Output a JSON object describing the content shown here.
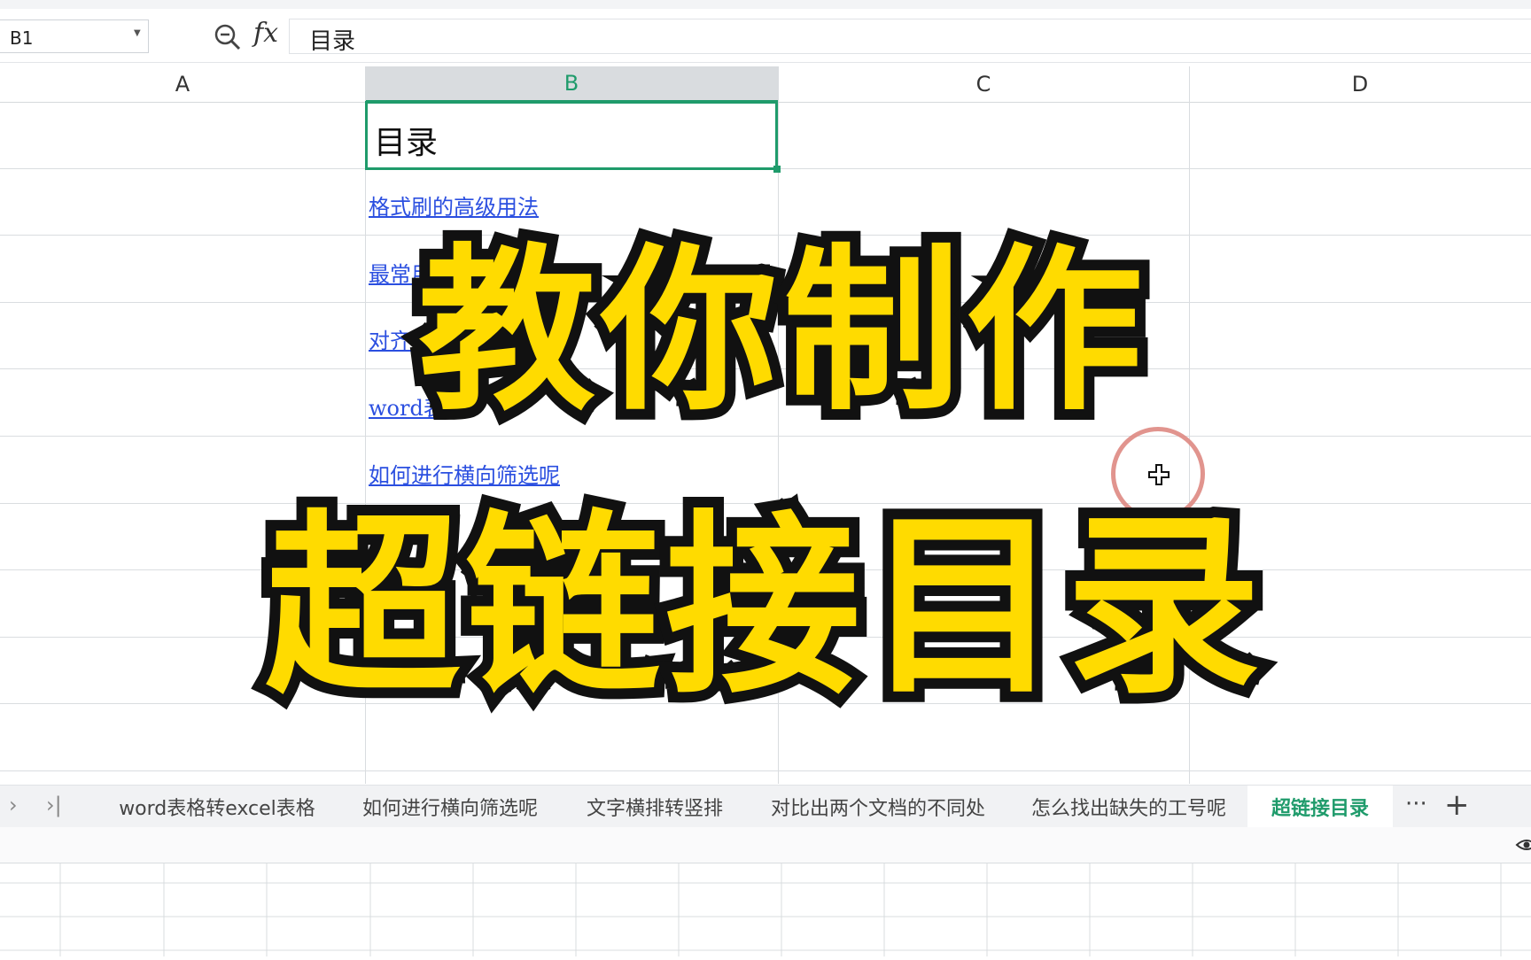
{
  "formula_bar": {
    "cell_ref": "B1",
    "fx_symbol": "fx",
    "formula_value": "目录"
  },
  "columns": [
    "A",
    "B",
    "C",
    "D"
  ],
  "sheet": {
    "title_cell": "目录",
    "links": [
      "格式刷的高级用法",
      "最常用的",
      "对齐名",
      "word表",
      "如何进行横向筛选呢"
    ]
  },
  "overlay": {
    "line1": "教你制作",
    "line2": "超链接目录",
    "fill_color": "#ffdb00",
    "stroke_color": "#111111"
  },
  "tabs": [
    {
      "label": "word表格转excel表格",
      "active": false
    },
    {
      "label": "如何进行横向筛选呢",
      "active": false
    },
    {
      "label": "文字横排转竖排",
      "active": false
    },
    {
      "label": "对比出两个文档的不同处",
      "active": false
    },
    {
      "label": "怎么找出缺失的工号呢",
      "active": false
    },
    {
      "label": "超链接目录",
      "active": true
    }
  ],
  "tab_nav": {
    "next": "›",
    "last": "›|",
    "more": "···",
    "add": "+"
  },
  "colors": {
    "accent": "#1f9b6b",
    "link": "#2b4fe0",
    "cursor_ring": "#de8882"
  },
  "icons": [
    "zoom-search-icon",
    "fx-icon",
    "move-cursor-icon",
    "eye-icon"
  ]
}
